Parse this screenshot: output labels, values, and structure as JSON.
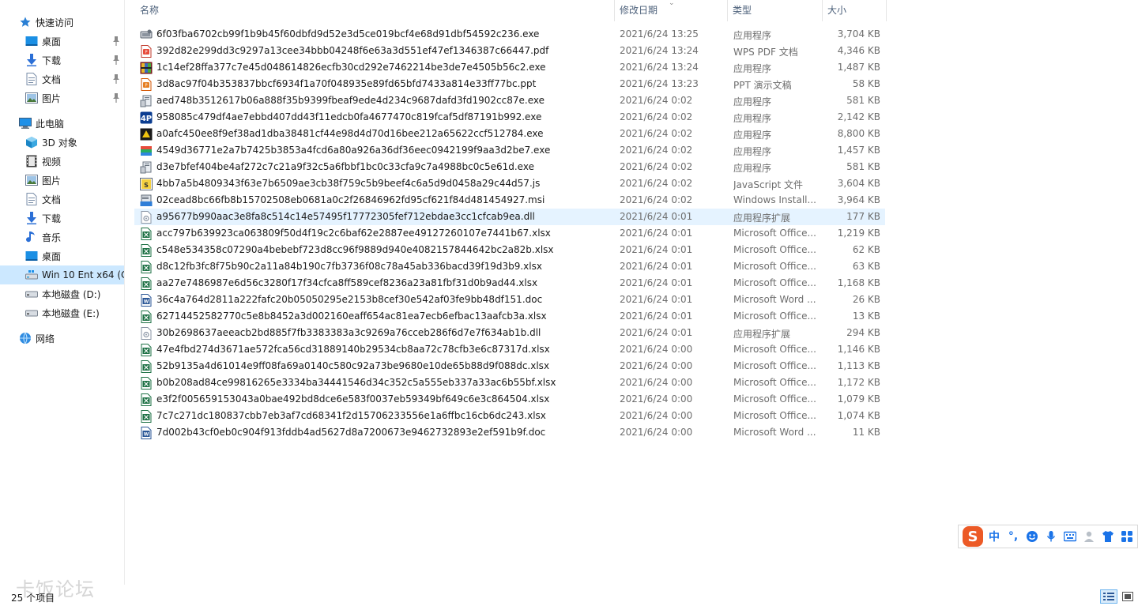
{
  "nav": {
    "items": [
      {
        "label": "快速访问",
        "icon": "star-icon",
        "level": 1,
        "pinned": false
      },
      {
        "label": "桌面",
        "icon": "desktop-icon",
        "level": 2,
        "pinned": true
      },
      {
        "label": "下载",
        "icon": "download-icon",
        "level": 2,
        "pinned": true
      },
      {
        "label": "文档",
        "icon": "document-icon",
        "level": 2,
        "pinned": true
      },
      {
        "label": "图片",
        "icon": "picture-icon",
        "level": 2,
        "pinned": true
      },
      {
        "label": "此电脑",
        "icon": "computer-icon",
        "level": 1,
        "pinned": false
      },
      {
        "label": "3D 对象",
        "icon": "cube-icon",
        "level": 2,
        "pinned": false
      },
      {
        "label": "视频",
        "icon": "video-icon",
        "level": 2,
        "pinned": false
      },
      {
        "label": "图片",
        "icon": "picture-icon",
        "level": 2,
        "pinned": false
      },
      {
        "label": "文档",
        "icon": "document-icon",
        "level": 2,
        "pinned": false
      },
      {
        "label": "下载",
        "icon": "download-icon",
        "level": 2,
        "pinned": false
      },
      {
        "label": "音乐",
        "icon": "music-icon",
        "level": 2,
        "pinned": false
      },
      {
        "label": "桌面",
        "icon": "desktop-icon",
        "level": 2,
        "pinned": false
      },
      {
        "label": "Win 10 Ent x64 (C",
        "icon": "system-drive-icon",
        "level": 2,
        "pinned": false,
        "selected": true
      },
      {
        "label": "本地磁盘 (D:)",
        "icon": "drive-icon",
        "level": 2,
        "pinned": false
      },
      {
        "label": "本地磁盘 (E:)",
        "icon": "drive-icon",
        "level": 2,
        "pinned": false
      },
      {
        "label": "网络",
        "icon": "network-icon",
        "level": 1,
        "pinned": false
      }
    ]
  },
  "columns": {
    "name": "名称",
    "date": "修改日期",
    "type": "类型",
    "size": "大小"
  },
  "files": [
    {
      "name": "6f03fba6702cb99f1b9b45f60dbfd9d52e3d5ce019bcf4e68d91dbf54592c236.exe",
      "date": "2021/6/24 13:25",
      "type": "应用程序",
      "size": "3,704 KB",
      "icon": "exe-installer-icon"
    },
    {
      "name": "392d82e299dd3c9297a13cee34bbb04248f6e63a3d551ef47ef1346387c66447.pdf",
      "date": "2021/6/24 13:24",
      "type": "WPS PDF 文档",
      "size": "4,346 KB",
      "icon": "pdf-icon"
    },
    {
      "name": "1c14ef28ffa377c7e45d048614826ecfb30cd292e7462214be3de7e4505b56c2.exe",
      "date": "2021/6/24 13:24",
      "type": "应用程序",
      "size": "1,487 KB",
      "icon": "archive-exe-icon"
    },
    {
      "name": "3d8ac97f04b353837bbcf6934f1a70f048935e89fd65bfd7433a814e33ff77bc.ppt",
      "date": "2021/6/24 13:23",
      "type": "PPT 演示文稿",
      "size": "58 KB",
      "icon": "ppt-icon"
    },
    {
      "name": "aed748b3512617b06a888f35b9399fbeaf9ede4d234c9687dafd3fd1902cc87e.exe",
      "date": "2021/6/24 0:02",
      "type": "应用程序",
      "size": "581 KB",
      "icon": "setup-exe-icon"
    },
    {
      "name": "958085c479df4ae7ebbd407dd43f11edcb0fa4677470c819fcaf5df87191b992.exe",
      "date": "2021/6/24 0:02",
      "type": "应用程序",
      "size": "2,142 KB",
      "icon": "app-exe-icon"
    },
    {
      "name": "a0afc450ee8f9ef38ad1dba38481cf44e98d4d70d16bee212a65622ccf512784.exe",
      "date": "2021/6/24 0:02",
      "type": "应用程序",
      "size": "8,800 KB",
      "icon": "dark-exe-icon"
    },
    {
      "name": "4549d36771e2a7b7425b3853a4fcd6a80a926a36df36eec0942199f9aa3d2be7.exe",
      "date": "2021/6/24 0:02",
      "type": "应用程序",
      "size": "1,457 KB",
      "icon": "books-exe-icon"
    },
    {
      "name": "d3e7bfef404be4af272c7c21a9f32c5a6fbbf1bc0c33cfa9c7a4988bc0c5e61d.exe",
      "date": "2021/6/24 0:02",
      "type": "应用程序",
      "size": "581 KB",
      "icon": "setup-exe-icon"
    },
    {
      "name": "4bb7a5b4809343f63e7b6509ae3cb38f759c5b9beef4c6a5d9d0458a29c44d57.js",
      "date": "2021/6/24 0:02",
      "type": "JavaScript 文件",
      "size": "3,604 KB",
      "icon": "js-icon"
    },
    {
      "name": "02cead8bc66fb8b15702508eb0681a0c2f26846962fd95cf621f84d481454927.msi",
      "date": "2021/6/24 0:02",
      "type": "Windows Install...",
      "size": "3,964 KB",
      "icon": "msi-icon"
    },
    {
      "name": "a95677b990aac3e8fa8c514c14e57495f17772305fef712ebdae3cc1cfcab9ea.dll",
      "date": "2021/6/24 0:01",
      "type": "应用程序扩展",
      "size": "177 KB",
      "icon": "dll-icon",
      "hover": true
    },
    {
      "name": "acc797b639923ca063809f50d4f19c2c6baf62e2887ee49127260107e7441b67.xlsx",
      "date": "2021/6/24 0:01",
      "type": "Microsoft Office...",
      "size": "1,219 KB",
      "icon": "xlsx-icon"
    },
    {
      "name": "c548e534358c07290a4bebebf723d8cc96f9889d940e4082157844642bc2a82b.xlsx",
      "date": "2021/6/24 0:01",
      "type": "Microsoft Office...",
      "size": "62 KB",
      "icon": "xlsx-icon"
    },
    {
      "name": "d8c12fb3fc8f75b90c2a11a84b190c7fb3736f08c78a45ab336bacd39f19d3b9.xlsx",
      "date": "2021/6/24 0:01",
      "type": "Microsoft Office...",
      "size": "63 KB",
      "icon": "xlsx-icon"
    },
    {
      "name": "aa27e7486987e6d56c3280f17f34cfca8ff589cef8236a23a81fbf31d0b9ad44.xlsx",
      "date": "2021/6/24 0:01",
      "type": "Microsoft Office...",
      "size": "1,168 KB",
      "icon": "xlsx-icon"
    },
    {
      "name": "36c4a764d2811a222fafc20b05050295e2153b8cef30e542af03fe9bb48df151.doc",
      "date": "2021/6/24 0:01",
      "type": "Microsoft Word ...",
      "size": "26 KB",
      "icon": "doc-icon"
    },
    {
      "name": "62714452582770c5e8b8452a3d002160eaff654ac81ea7ecb6efbac13aafcb3a.xlsx",
      "date": "2021/6/24 0:01",
      "type": "Microsoft Office...",
      "size": "13 KB",
      "icon": "xlsx-icon"
    },
    {
      "name": "30b2698637aeeacb2bd885f7fb3383383a3c9269a76cceb286f6d7e7f634ab1b.dll",
      "date": "2021/6/24 0:01",
      "type": "应用程序扩展",
      "size": "294 KB",
      "icon": "dll-icon"
    },
    {
      "name": "47e4fbd274d3671ae572fca56cd31889140b29534cb8aa72c78cfb3e6c87317d.xlsx",
      "date": "2021/6/24 0:00",
      "type": "Microsoft Office...",
      "size": "1,146 KB",
      "icon": "xlsx-icon"
    },
    {
      "name": "52b9135a4d61014e9ff08fa69a0140c580c92a73be9680e10de65b88d9f088dc.xlsx",
      "date": "2021/6/24 0:00",
      "type": "Microsoft Office...",
      "size": "1,113 KB",
      "icon": "xlsx-icon"
    },
    {
      "name": "b0b208ad84ce99816265e3334ba34441546d34c352c5a555eb337a33ac6b55bf.xlsx",
      "date": "2021/6/24 0:00",
      "type": "Microsoft Office...",
      "size": "1,172 KB",
      "icon": "xlsx-icon"
    },
    {
      "name": "e3f2f005659153043a0bae492bd8dce6e583f0037eb59349bf649c6e3c864504.xlsx",
      "date": "2021/6/24 0:00",
      "type": "Microsoft Office...",
      "size": "1,079 KB",
      "icon": "xlsx-icon"
    },
    {
      "name": "7c7c271dc180837cbb7eb3af7cd68341f2d15706233556e1a6ffbc16cb6dc243.xlsx",
      "date": "2021/6/24 0:00",
      "type": "Microsoft Office...",
      "size": "1,074 KB",
      "icon": "xlsx-icon"
    },
    {
      "name": "7d002b43cf0eb0c904f913fddb4ad5627d8a7200673e9462732893e2ef591b9f.doc",
      "date": "2021/6/24 0:00",
      "type": "Microsoft Word ...",
      "size": "11 KB",
      "icon": "doc-icon"
    }
  ],
  "status": {
    "count": "25 个项目"
  },
  "watermark": "卡饭论坛",
  "ime": {
    "mode": "中",
    "punct": "°,",
    "icons": [
      "sogou-logo-icon",
      "emoji-icon",
      "microphone-icon",
      "keyboard-icon",
      "user-icon",
      "skin-icon",
      "toolbox-icon"
    ]
  },
  "colors": {
    "selected": "#cce8ff",
    "hover": "#e5f3ff",
    "header_text": "#4c607a",
    "xlsx": "#1e7145",
    "doc": "#2b5797",
    "ime_logo": "#ec5a26"
  }
}
